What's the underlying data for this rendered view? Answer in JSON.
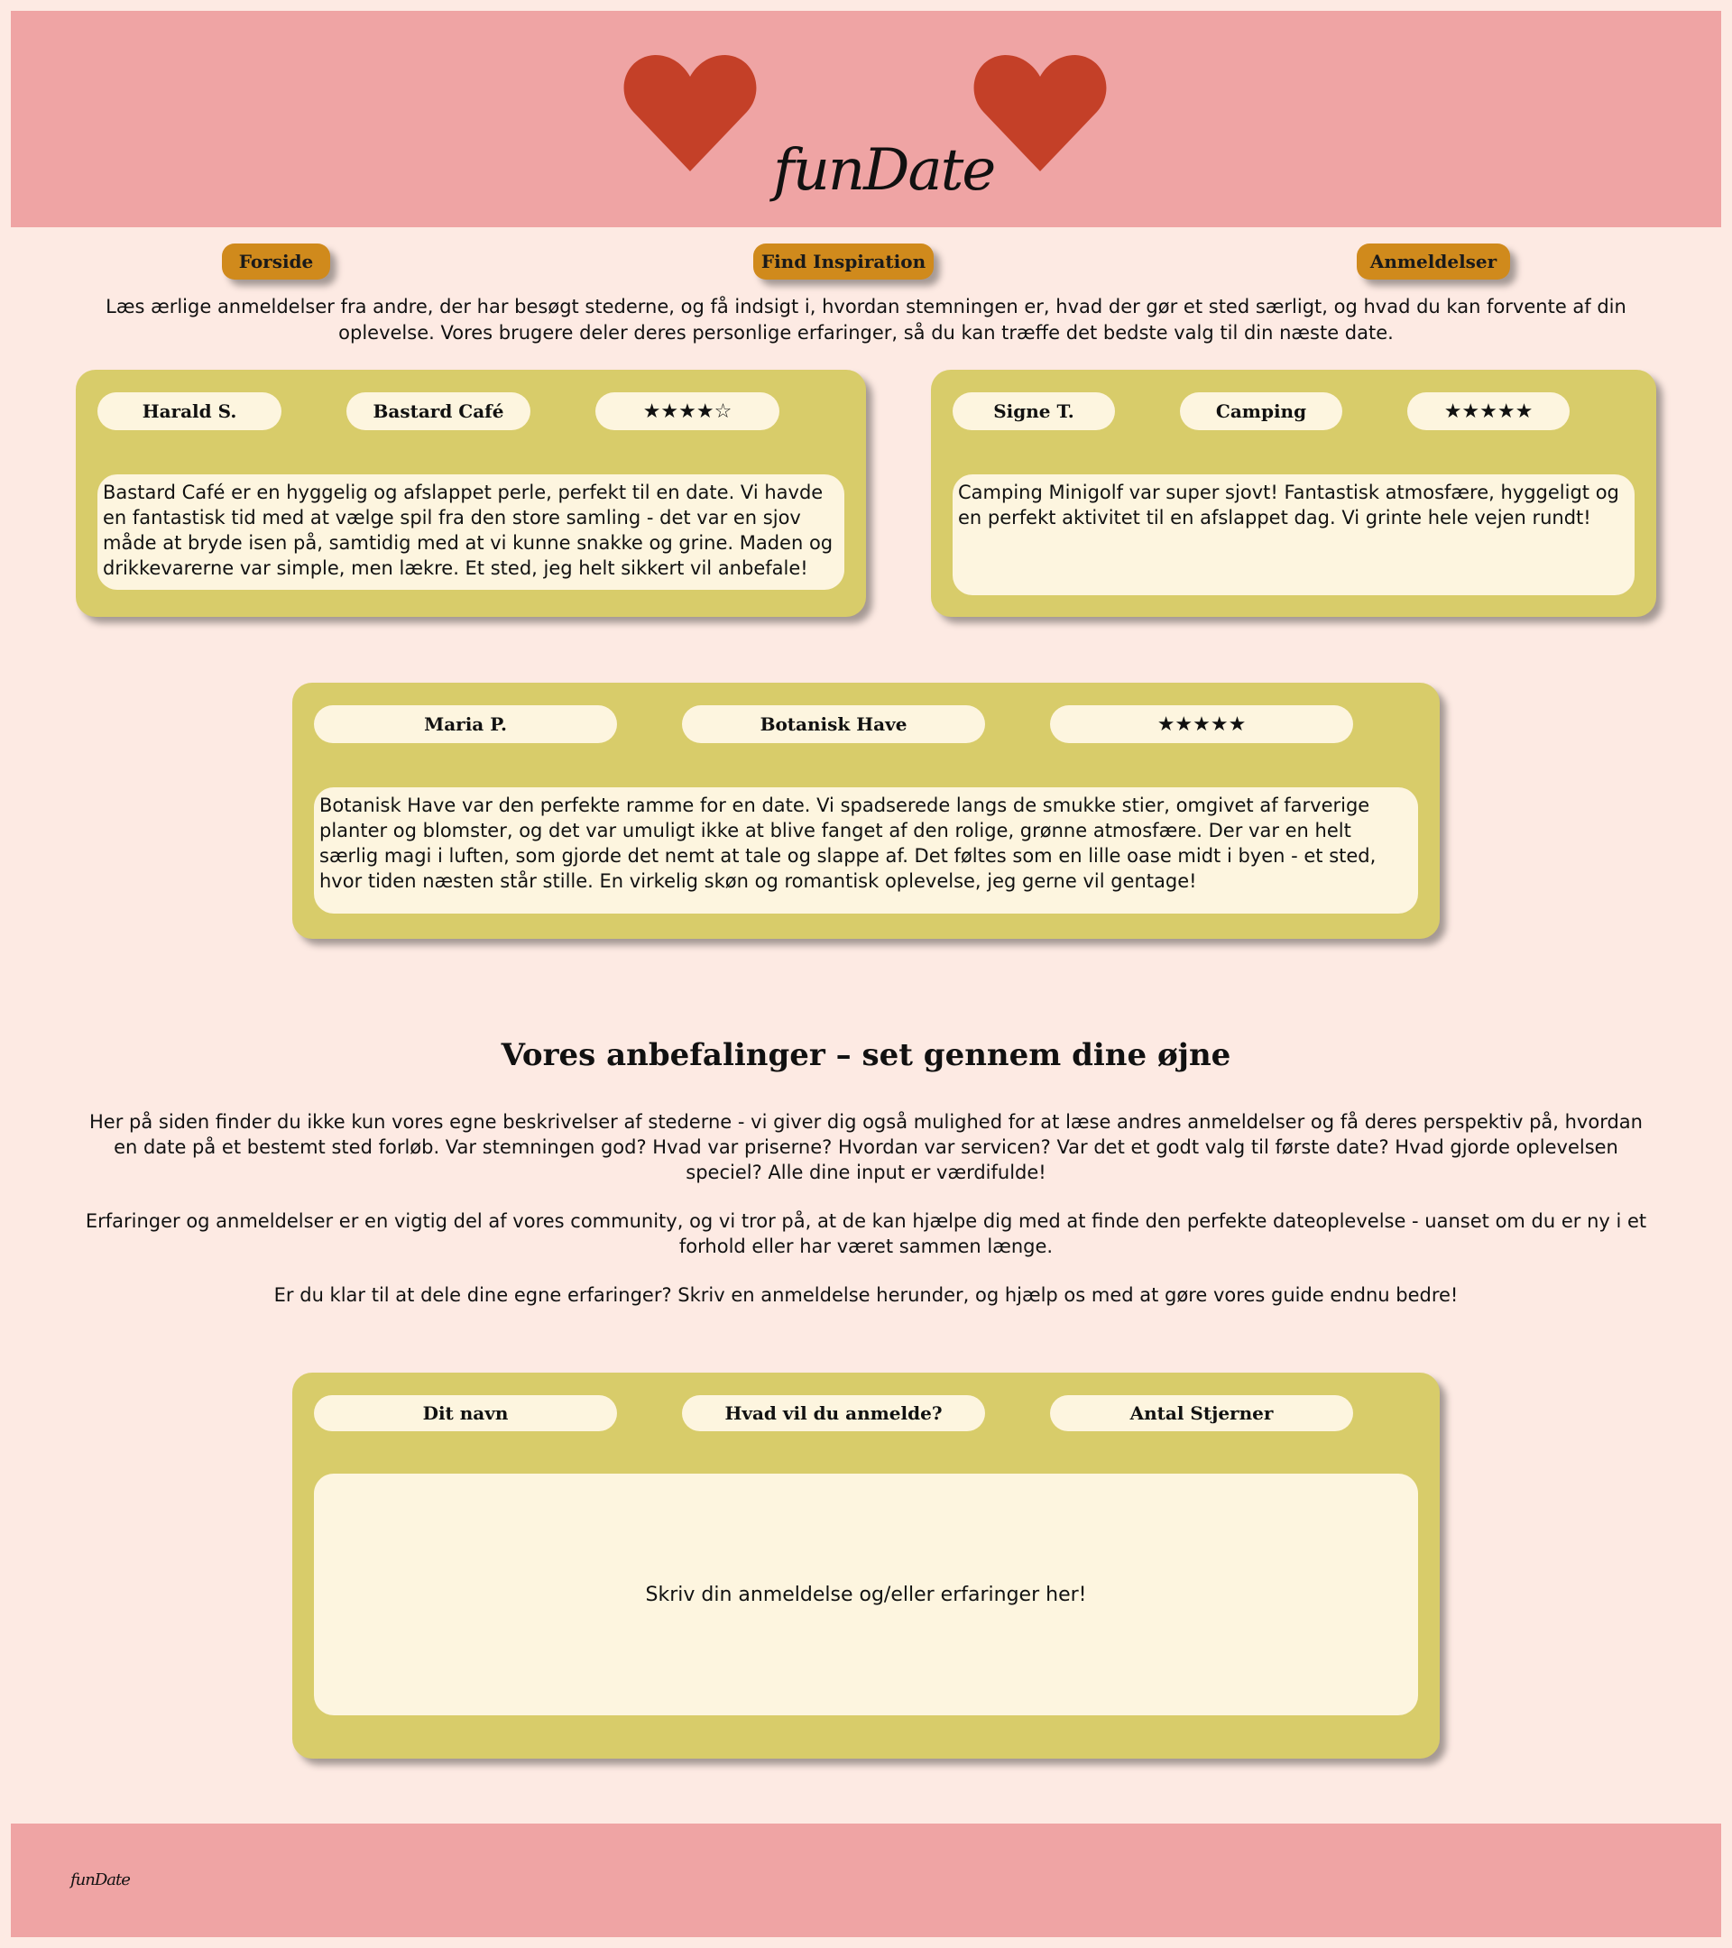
{
  "brand": {
    "logo": "funDate",
    "heart_color": "#c44028"
  },
  "nav": [
    {
      "label": "Forside"
    },
    {
      "label": "Find Inspiration"
    },
    {
      "label": "Anmeldelser"
    }
  ],
  "intro": "Læs ærlige anmeldelser fra andre, der har besøgt stederne, og få indsigt i, hvordan stemningen er, hvad der gør et sted særligt, og hvad du kan forvente af din oplevelse. Vores brugere deler deres personlige erfaringer, så du kan træffe det bedste valg til din næste date.",
  "reviews": [
    {
      "name": "Harald S.",
      "place": "Bastard Café",
      "stars": "★★★★☆",
      "rating": 4,
      "text": "Bastard Café er en hyggelig og afslappet perle, perfekt til en date. Vi havde en fantastisk tid med at vælge spil fra den store samling - det var en sjov måde at bryde isen på, samtidig med at vi kunne snakke og grine. Maden og drikkevarerne var simple, men lækre. Et sted, jeg helt sikkert vil anbefale!"
    },
    {
      "name": "Signe T.",
      "place": "Camping",
      "stars": "★★★★★",
      "rating": 5,
      "text": "Camping Minigolf var super sjovt! Fantastisk atmosfære, hyggeligt og en perfekt aktivitet til en afslappet dag. Vi grinte hele vejen rundt!"
    },
    {
      "name": "Maria P.",
      "place": "Botanisk Have",
      "stars": "★★★★★",
      "rating": 5,
      "text": "Botanisk Have var den perfekte ramme for en date. Vi spadserede langs de smukke stier, omgivet af farverige planter og blomster, og det var umuligt ikke at blive fanget af den rolige, grønne atmosfære. Der var en helt særlig magi i luften, som gjorde det nemt at tale og slappe af. Det føltes som en lille oase midt i byen - et sted, hvor tiden næsten står stille. En virkelig skøn og romantisk oplevelse, jeg gerne vil gentage!"
    }
  ],
  "recommendations": {
    "title": "Vores anbefalinger – set gennem dine øjne",
    "p1": "Her på siden finder du ikke kun vores egne beskrivelser af stederne - vi giver dig også mulighed for at læse andres anmeldelser og få deres perspektiv på, hvordan en date på et bestemt sted forløb. Var stemningen god? Hvad var priserne? Hvordan var servicen? Var det et godt valg til første date? Hvad gjorde oplevelsen speciel? Alle dine input er værdifulde!",
    "p2": "Erfaringer og anmeldelser er en vigtig del af vores community, og vi tror på, at de kan hjælpe dig med at finde den perfekte dateoplevelse - uanset om du er ny i et forhold eller har været sammen længe.",
    "p3": "Er du klar til at dele dine egne erfaringer? Skriv en anmeldelse herunder, og hjælp os med at gøre vores guide endnu bedre!"
  },
  "form": {
    "name_label": "Dit navn",
    "place_label": "Hvad vil du anmelde?",
    "stars_label": "Antal Stjerner",
    "review_placeholder": "Skriv din anmeldelse og/eller erfaringer her!"
  },
  "colors": {
    "header": "#efa4a4",
    "background": "#fdeae3",
    "card": "#d8cc6a",
    "pill": "#fdf5df",
    "nav_button": "#d08a1c"
  }
}
